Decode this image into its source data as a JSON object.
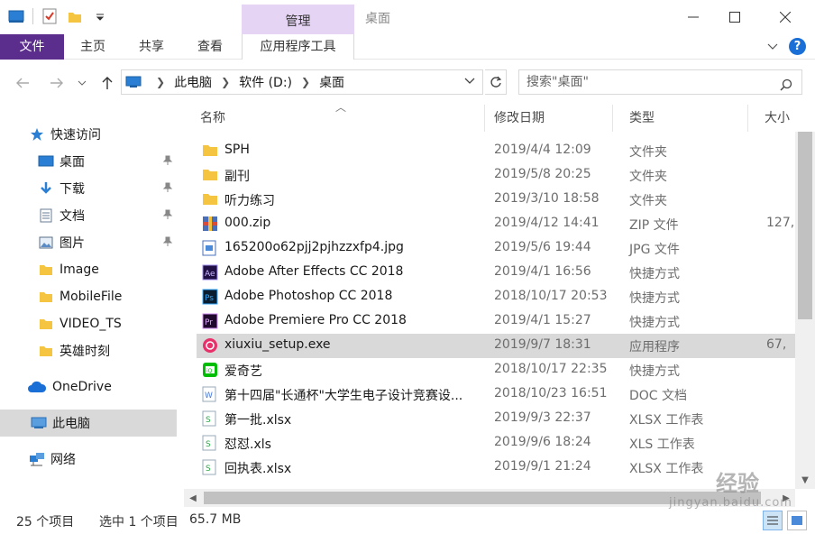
{
  "window": {
    "title": "桌面",
    "manage_tab": "管理"
  },
  "ribbon": {
    "tabs": [
      "文件",
      "主页",
      "共享",
      "查看",
      "应用程序工具"
    ]
  },
  "address": {
    "crumbs": [
      "此电脑",
      "软件 (D:)",
      "桌面"
    ],
    "search_placeholder": "搜索\"桌面\""
  },
  "sidebar": {
    "items": [
      {
        "label": "快速访问",
        "icon": "star-icon",
        "pinned": false
      },
      {
        "label": "桌面",
        "icon": "desktop-icon",
        "pinned": true
      },
      {
        "label": "下载",
        "icon": "download-icon",
        "pinned": true
      },
      {
        "label": "文档",
        "icon": "document-icon",
        "pinned": true
      },
      {
        "label": "图片",
        "icon": "picture-icon",
        "pinned": true
      },
      {
        "label": "Image",
        "icon": "folder-icon",
        "pinned": false
      },
      {
        "label": "MobileFile",
        "icon": "folder-icon",
        "pinned": false
      },
      {
        "label": "VIDEO_TS",
        "icon": "folder-icon",
        "pinned": false
      },
      {
        "label": "英雄时刻",
        "icon": "folder-icon",
        "pinned": false
      },
      {
        "label": "OneDrive",
        "icon": "cloud-icon",
        "pinned": false
      },
      {
        "label": "此电脑",
        "icon": "computer-icon",
        "pinned": false,
        "selected": true
      },
      {
        "label": "网络",
        "icon": "network-icon",
        "pinned": false
      }
    ]
  },
  "columns": [
    "名称",
    "修改日期",
    "类型",
    "大小"
  ],
  "files": [
    {
      "name": "SPH",
      "date": "2019/4/4 12:09",
      "type": "文件夹",
      "size": "",
      "icon": "folder-icon"
    },
    {
      "name": "副刊",
      "date": "2019/5/8 20:25",
      "type": "文件夹",
      "size": "",
      "icon": "folder-icon"
    },
    {
      "name": "听力练习",
      "date": "2019/3/10 18:58",
      "type": "文件夹",
      "size": "",
      "icon": "folder-icon"
    },
    {
      "name": "000.zip",
      "date": "2019/4/12 14:41",
      "type": "ZIP 文件",
      "size": "127,",
      "icon": "zip-icon"
    },
    {
      "name": "165200o62pjj2pjhzzxfp4.jpg",
      "date": "2019/5/6 19:44",
      "type": "JPG 文件",
      "size": "",
      "icon": "image-file-icon"
    },
    {
      "name": "Adobe After Effects CC 2018",
      "date": "2019/4/1 16:56",
      "type": "快捷方式",
      "size": "",
      "icon": "after-effects-icon"
    },
    {
      "name": "Adobe Photoshop CC 2018",
      "date": "2018/10/17 20:53",
      "type": "快捷方式",
      "size": "",
      "icon": "photoshop-icon"
    },
    {
      "name": "Adobe Premiere Pro CC 2018",
      "date": "2019/4/1 15:27",
      "type": "快捷方式",
      "size": "",
      "icon": "premiere-icon"
    },
    {
      "name": "xiuxiu_setup.exe",
      "date": "2019/9/7 18:31",
      "type": "应用程序",
      "size": "67,",
      "icon": "xiuxiu-icon",
      "selected": true
    },
    {
      "name": "爱奇艺",
      "date": "2018/10/17 22:35",
      "type": "快捷方式",
      "size": "",
      "icon": "iqiyi-icon"
    },
    {
      "name": "第十四届\"长通杯\"大学生电子设计竞赛设...",
      "date": "2018/10/23 16:51",
      "type": "DOC 文档",
      "size": "",
      "icon": "doc-icon"
    },
    {
      "name": "第一批.xlsx",
      "date": "2019/9/3 22:37",
      "type": "XLSX 工作表",
      "size": "",
      "icon": "sheet-icon"
    },
    {
      "name": "怼怼.xls",
      "date": "2019/9/6 18:24",
      "type": "XLS 工作表",
      "size": "",
      "icon": "sheet-icon"
    },
    {
      "name": "回执表.xlsx",
      "date": "2019/9/1 21:24",
      "type": "XLSX 工作表",
      "size": "",
      "icon": "sheet-icon"
    }
  ],
  "status": {
    "count": "25 个项目",
    "selection": "选中 1 个项目",
    "size": "65.7 MB"
  },
  "watermark": {
    "brand": "经验",
    "url": "jingyan.baidu.com"
  },
  "colors": {
    "file_tab": "#5b2d8c",
    "manage_tab": "#e6d4f5",
    "selection": "#d9d9d9",
    "folder": "#f5c542"
  }
}
